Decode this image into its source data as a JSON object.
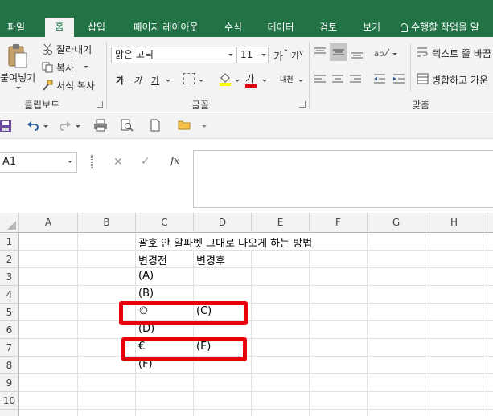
{
  "ribbon_tabs": [
    "파일",
    "홈",
    "삽입",
    "페이지 레이아웃",
    "수식",
    "데이터",
    "검토",
    "보기"
  ],
  "tell_me": "수행할 작업을 알",
  "clipboard": {
    "paste": "붙여넣기",
    "cut": "잘라내기",
    "copy": "복사",
    "format_painter": "서식 복사",
    "group_label": "클립보드"
  },
  "font": {
    "name": "맑은 고딕",
    "size": "11",
    "bold": "가",
    "italic": "가",
    "underline": "가",
    "font_color_glyph": "가",
    "phonetic_glyph": "내천",
    "group_label": "글꼴"
  },
  "alignment": {
    "wrap_text": "텍스트 줄 바꿈",
    "merge_center": "병합하고 가운",
    "group_label": "맞춤"
  },
  "name_box": "A1",
  "fx": "fx",
  "columns": [
    "A",
    "B",
    "C",
    "D",
    "E",
    "F",
    "G",
    "H"
  ],
  "rows": [
    "1",
    "2",
    "3",
    "4",
    "5",
    "6",
    "7",
    "8",
    "9",
    "10"
  ],
  "cells": {
    "c1": "괄호 안 알파벳 그대로 나오게 하는 방법",
    "c2": "변경전",
    "d2": "변경후",
    "c3": "(A)",
    "c4": "(B)",
    "c5": "©",
    "d5": "(C)",
    "c6": "(D)",
    "c7": "€",
    "d7": "(E)",
    "c8": "(F)"
  },
  "colors": {
    "ribbon_green": "#217346",
    "highlight_red": "#e8000b"
  }
}
